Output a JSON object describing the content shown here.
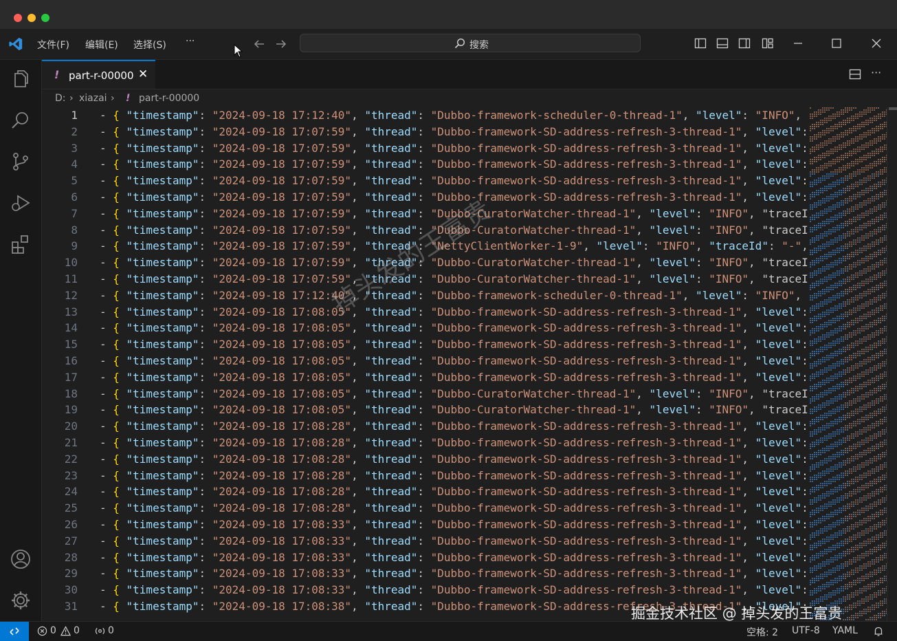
{
  "menu": {
    "file": "文件(F)",
    "edit": "编辑(E)",
    "select": "选择(S)",
    "more": "···"
  },
  "search": {
    "label": "搜索"
  },
  "tab": {
    "name": "part-r-00000",
    "close": "✕",
    "modified_marker": "!"
  },
  "breadcrumb": {
    "drive": "D:",
    "folder": "xiazai",
    "file": "part-r-00000",
    "marker": "!"
  },
  "editor_lines": [
    {
      "n": "1",
      "ts": "2024-09-18 17:12:40",
      "thread": "Dubbo-framework-scheduler-0-thread-1",
      "tail": ", \"level\": \"INFO\","
    },
    {
      "n": "2",
      "ts": "2024-09-18 17:07:59",
      "thread": "Dubbo-framework-SD-address-refresh-3-thread-1",
      "tail": ", \"level\":"
    },
    {
      "n": "3",
      "ts": "2024-09-18 17:07:59",
      "thread": "Dubbo-framework-SD-address-refresh-3-thread-1",
      "tail": ", \"level\":"
    },
    {
      "n": "4",
      "ts": "2024-09-18 17:07:59",
      "thread": "Dubbo-framework-SD-address-refresh-3-thread-1",
      "tail": ", \"level\":"
    },
    {
      "n": "5",
      "ts": "2024-09-18 17:07:59",
      "thread": "Dubbo-framework-SD-address-refresh-3-thread-1",
      "tail": ", \"level\":"
    },
    {
      "n": "6",
      "ts": "2024-09-18 17:07:59",
      "thread": "Dubbo-framework-SD-address-refresh-3-thread-1",
      "tail": ", \"level\":"
    },
    {
      "n": "7",
      "ts": "2024-09-18 17:07:59",
      "thread": "Dubbo-CuratorWatcher-thread-1",
      "tail": ", \"level\": \"INFO\", \"traceI"
    },
    {
      "n": "8",
      "ts": "2024-09-18 17:07:59",
      "thread": "Dubbo-CuratorWatcher-thread-1",
      "tail": ", \"level\": \"INFO\", \"traceI"
    },
    {
      "n": "9",
      "ts": "2024-09-18 17:07:59",
      "thread": "NettyClientWorker-1-9",
      "tail": ", \"level\": \"INFO\", \"traceId\": \"-\","
    },
    {
      "n": "10",
      "ts": "2024-09-18 17:07:59",
      "thread": "Dubbo-CuratorWatcher-thread-1",
      "tail": ", \"level\": \"INFO\", \"traceI"
    },
    {
      "n": "11",
      "ts": "2024-09-18 17:07:59",
      "thread": "Dubbo-CuratorWatcher-thread-1",
      "tail": ", \"level\": \"INFO\", \"traceI"
    },
    {
      "n": "12",
      "ts": "2024-09-18 17:12:40",
      "thread": "Dubbo-framework-scheduler-0-thread-1",
      "tail": ", \"level\": \"INFO\","
    },
    {
      "n": "13",
      "ts": "2024-09-18 17:08:05",
      "thread": "Dubbo-framework-SD-address-refresh-3-thread-1",
      "tail": ", \"level\":"
    },
    {
      "n": "14",
      "ts": "2024-09-18 17:08:05",
      "thread": "Dubbo-framework-SD-address-refresh-3-thread-1",
      "tail": ", \"level\":"
    },
    {
      "n": "15",
      "ts": "2024-09-18 17:08:05",
      "thread": "Dubbo-framework-SD-address-refresh-3-thread-1",
      "tail": ", \"level\":"
    },
    {
      "n": "16",
      "ts": "2024-09-18 17:08:05",
      "thread": "Dubbo-framework-SD-address-refresh-3-thread-1",
      "tail": ", \"level\":"
    },
    {
      "n": "17",
      "ts": "2024-09-18 17:08:05",
      "thread": "Dubbo-framework-SD-address-refresh-3-thread-1",
      "tail": ", \"level\":"
    },
    {
      "n": "18",
      "ts": "2024-09-18 17:08:05",
      "thread": "Dubbo-CuratorWatcher-thread-1",
      "tail": ", \"level\": \"INFO\", \"traceI"
    },
    {
      "n": "19",
      "ts": "2024-09-18 17:08:05",
      "thread": "Dubbo-CuratorWatcher-thread-1",
      "tail": ", \"level\": \"INFO\", \"traceI"
    },
    {
      "n": "20",
      "ts": "2024-09-18 17:08:28",
      "thread": "Dubbo-framework-SD-address-refresh-3-thread-1",
      "tail": ", \"level\":"
    },
    {
      "n": "21",
      "ts": "2024-09-18 17:08:28",
      "thread": "Dubbo-framework-SD-address-refresh-3-thread-1",
      "tail": ", \"level\":"
    },
    {
      "n": "22",
      "ts": "2024-09-18 17:08:28",
      "thread": "Dubbo-framework-SD-address-refresh-3-thread-1",
      "tail": ", \"level\":"
    },
    {
      "n": "23",
      "ts": "2024-09-18 17:08:28",
      "thread": "Dubbo-framework-SD-address-refresh-3-thread-1",
      "tail": ", \"level\":"
    },
    {
      "n": "24",
      "ts": "2024-09-18 17:08:28",
      "thread": "Dubbo-framework-SD-address-refresh-3-thread-1",
      "tail": ", \"level\":"
    },
    {
      "n": "25",
      "ts": "2024-09-18 17:08:28",
      "thread": "Dubbo-framework-SD-address-refresh-3-thread-1",
      "tail": ", \"level\":"
    },
    {
      "n": "26",
      "ts": "2024-09-18 17:08:33",
      "thread": "Dubbo-framework-SD-address-refresh-3-thread-1",
      "tail": ", \"level\":"
    },
    {
      "n": "27",
      "ts": "2024-09-18 17:08:33",
      "thread": "Dubbo-framework-SD-address-refresh-3-thread-1",
      "tail": ", \"level\":"
    },
    {
      "n": "28",
      "ts": "2024-09-18 17:08:33",
      "thread": "Dubbo-framework-SD-address-refresh-3-thread-1",
      "tail": ", \"level\":"
    },
    {
      "n": "29",
      "ts": "2024-09-18 17:08:33",
      "thread": "Dubbo-framework-SD-address-refresh-3-thread-1",
      "tail": ", \"level\":"
    },
    {
      "n": "30",
      "ts": "2024-09-18 17:08:33",
      "thread": "Dubbo-framework-SD-address-refresh-3-thread-1",
      "tail": ", \"level\":"
    },
    {
      "n": "31",
      "ts": "2024-09-18 17:08:38",
      "thread": "Dubbo-framework-SD-address-refresh-3-thread-1",
      "tail": ", \"level\":"
    }
  ],
  "status": {
    "errors": "0",
    "warnings": "0",
    "ports": "0",
    "indent": "空格: 2",
    "encoding": "UTF-8",
    "language": "YAML"
  },
  "watermark": {
    "corner": "掘金技术社区 @ 掉头发的王富贵",
    "diagonal": "掉头发的王富贵"
  },
  "colors": {
    "accent": "#0078d4",
    "string": "#ce9178",
    "key": "#9cdcfe",
    "bracket": "#ffd700"
  }
}
